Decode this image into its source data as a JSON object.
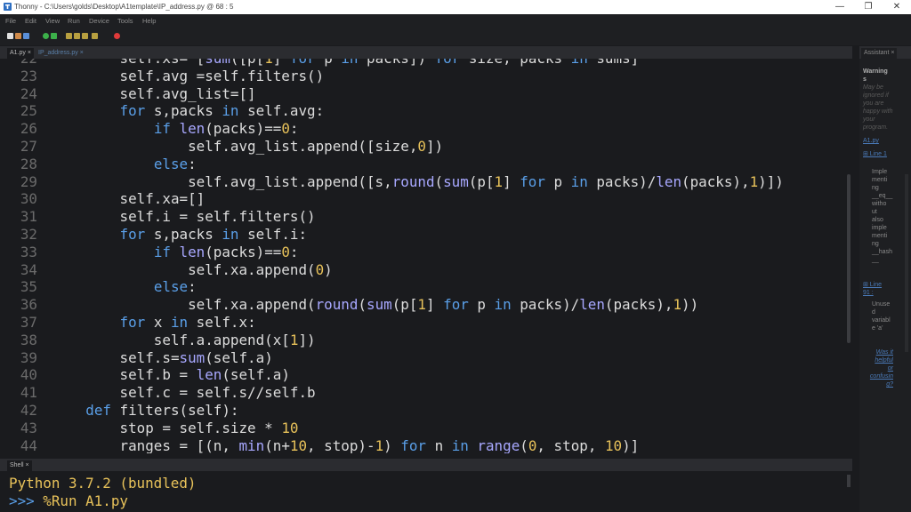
{
  "window": {
    "title": "Thonny  -  C:\\Users\\golds\\Desktop\\A1template\\IP_address.py  @  68 : 5",
    "controls": [
      "minimize",
      "maximize",
      "close"
    ]
  },
  "menu": [
    "File",
    "Edit",
    "View",
    "Run",
    "Device",
    "Tools",
    "Help"
  ],
  "toolbar": [
    {
      "icon": "new-file-icon",
      "color": "#e0e0e0"
    },
    {
      "icon": "open-file-icon",
      "color": "#d08a4a"
    },
    {
      "icon": "save-icon",
      "color": "#5a8fd8"
    },
    {
      "icon": "run-icon",
      "color": "#3cb04a"
    },
    {
      "icon": "debug-icon",
      "color": "#3cb04a"
    },
    {
      "icon": "step-over-icon",
      "color": "#b8a040"
    },
    {
      "icon": "step-into-icon",
      "color": "#b8a040"
    },
    {
      "icon": "step-out-icon",
      "color": "#b8a040"
    },
    {
      "icon": "resume-icon",
      "color": "#b8a040"
    },
    {
      "icon": "stop-icon",
      "color": "#e03a3a"
    }
  ],
  "editor_tabs": [
    {
      "label": "A1.py ×",
      "active": true
    },
    {
      "label": "IP_address.py ×",
      "active": false
    }
  ],
  "editor": {
    "lines": [
      {
        "n": "22",
        "code": "        self.xs= [sum([p[1] for p in packs]) for size, packs in sums]"
      },
      {
        "n": "23",
        "code": "        self.avg =self.filters()"
      },
      {
        "n": "24",
        "code": "        self.avg_list=[]"
      },
      {
        "n": "25",
        "code": "        for s,packs in self.avg:"
      },
      {
        "n": "26",
        "code": "            if len(packs)==0:"
      },
      {
        "n": "27",
        "code": "                self.avg_list.append([size,0])"
      },
      {
        "n": "28",
        "code": "            else:"
      },
      {
        "n": "29",
        "code": "                self.avg_list.append([s,round(sum(p[1] for p in packs)/len(packs),1)])"
      },
      {
        "n": "30",
        "code": "        self.xa=[]"
      },
      {
        "n": "31",
        "code": "        self.i = self.filters()"
      },
      {
        "n": "32",
        "code": "        for s,packs in self.i:"
      },
      {
        "n": "33",
        "code": "            if len(packs)==0:"
      },
      {
        "n": "34",
        "code": "                self.xa.append(0)"
      },
      {
        "n": "35",
        "code": "            else:"
      },
      {
        "n": "36",
        "code": "                self.xa.append(round(sum(p[1] for p in packs)/len(packs),1))"
      },
      {
        "n": "37",
        "code": "        for x in self.x:"
      },
      {
        "n": "38",
        "code": "            self.a.append(x[1])"
      },
      {
        "n": "39",
        "code": "        self.s=sum(self.a)"
      },
      {
        "n": "40",
        "code": "        self.b = len(self.a)"
      },
      {
        "n": "41",
        "code": "        self.c = self.s//self.b"
      },
      {
        "n": "42",
        "code": "    def filters(self):"
      },
      {
        "n": "43",
        "code": "        stop = self.size * 10"
      },
      {
        "n": "44",
        "code": "        ranges = [(n, min(n+10, stop)-1) for n in range(0, stop, 10)]"
      }
    ]
  },
  "shell": {
    "tab_label": "Shell ×",
    "lines": [
      {
        "text": "Python 3.7.2 (bundled)",
        "color": "#e8c25a"
      },
      {
        "prompt": ">>> ",
        "text": "%Run A1.py",
        "color": "#e8c25a"
      }
    ]
  },
  "assistant": {
    "tab_label": "Assistant ×",
    "items": [
      {
        "text": "Warning\ns",
        "style": "bold"
      },
      {
        "text": "May be\nignored if\nyou are\nhappy with\nyour\nprogram.",
        "style": "it"
      },
      {
        "text": "A1.py",
        "style": "link"
      },
      {
        "text": "⊞ Line 1",
        "style": "link"
      },
      {
        "text": "Imple\nmenti\nng\n__eq__\nwitho\nut\nalso\nimple\nmenti\nng\n__hash\n__",
        "style": "dim"
      },
      {
        "text": "⊞ Line\n91 :",
        "style": "link"
      },
      {
        "text": "Unuse\nd\nvariabl\ne 'a'",
        "style": "dim"
      },
      {
        "text": "Was it\nhelpful\nor\nconfusin\ng?",
        "style": "it-link"
      }
    ]
  },
  "colors": {
    "keyword": "#5a9fe8",
    "builtin": "#a8a8ff",
    "number": "#e8c25a",
    "text": "#dcdcdc",
    "background": "#1a1b1e"
  }
}
